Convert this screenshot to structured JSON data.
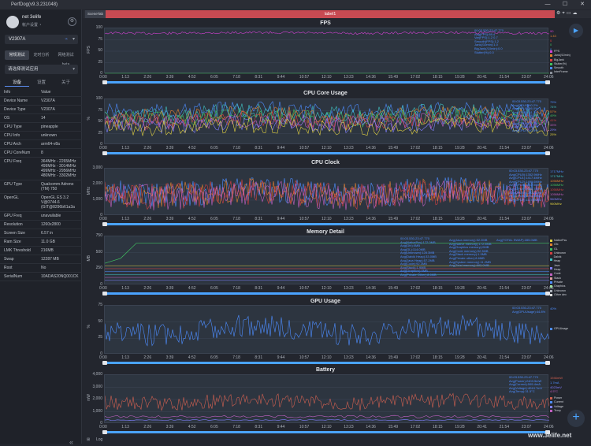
{
  "window": {
    "title": "PerfDog(v9.3.231048)",
    "min": "—",
    "max": "☐",
    "close": "✕"
  },
  "user": {
    "name": "net 3elife",
    "sub": "帐户设置 ◔"
  },
  "device_selector": {
    "label": "V2307A"
  },
  "mode_tabs": [
    {
      "label": "常规测试"
    },
    {
      "label": "定时分析"
    },
    {
      "label": "网络测试 beta"
    }
  ],
  "app_selector": {
    "placeholder": "请选择测试应用"
  },
  "info_tabs": [
    {
      "label": "设备"
    },
    {
      "label": "设置"
    },
    {
      "label": "关于"
    }
  ],
  "info": [
    {
      "k": "Info",
      "v": "Value"
    },
    {
      "k": "Device Name",
      "v": "V2307A"
    },
    {
      "k": "Device Type",
      "v": "V2307A"
    },
    {
      "k": "OS",
      "v": "14"
    },
    {
      "k": "CPU Type",
      "v": "pineapple"
    },
    {
      "k": "CPU Info",
      "v": "unknown"
    },
    {
      "k": "CPU Arch",
      "v": "arm64-v8a"
    },
    {
      "k": "CPU CoreNum",
      "v": "8"
    },
    {
      "k": "CPU Freq",
      "v": "364MHz - 2265MHz\n499MHz - 3014MHz\n499MHz - 2956MHz\n480MHz - 3302MHz"
    },
    {
      "k": "GPU Type",
      "v": "Qualcomm Adreno\n(TM) 750"
    },
    {
      "k": "OpenGL",
      "v": "OpenGL ES 3.2\nV@0744.6\n(GIT@8296b61a3a"
    },
    {
      "k": "GPU Freq",
      "v": "unavailable"
    },
    {
      "k": "Resolution",
      "v": "1260x2800"
    },
    {
      "k": "Screen Size",
      "v": "6.57 in"
    },
    {
      "k": "Ram Size",
      "v": "11.0 GB"
    },
    {
      "k": "LMK Threshold",
      "v": "216MB"
    },
    {
      "k": "Swap",
      "v": "12287 MB"
    },
    {
      "k": "Root",
      "v": "No"
    },
    {
      "k": "SerialNum",
      "v": "10ADAS20NQ001CK"
    }
  ],
  "tabs": {
    "scene": "SceneTab",
    "label": "label1"
  },
  "x_ticks": [
    "0:00",
    "1:13",
    "2:26",
    "3:39",
    "4:52",
    "6:05",
    "7:18",
    "8:31",
    "9:44",
    "10:57",
    "12:10",
    "13:23",
    "14:36",
    "15:49",
    "17:02",
    "18:15",
    "19:28",
    "20:41",
    "21:54",
    "23:07",
    "24:06"
  ],
  "panels": [
    {
      "title": "FPS",
      "unit": "FPS",
      "yticks": [
        "100",
        "75",
        "50",
        "25",
        "0"
      ],
      "ann": "00:03.530-23:47.770\nAvg(FPS):89.4\nVar(FPS):1.2 0.7\nSmooth(FPS):1.2\nJank(/10min):1.0\nBigJank(/10min):0.0\nStutter(%):0.0",
      "legend": [
        [
          "FPS",
          "#d040d0"
        ],
        [
          "Jank(/10min)",
          "#e08030"
        ],
        [
          "BigJank",
          "#e04040"
        ],
        [
          "Stutter(%)",
          "#40c060"
        ],
        [
          "Smooth",
          "#4d8dff"
        ],
        [
          "InterFrame",
          "#8a909a"
        ]
      ],
      "rvals": [
        [
          "90",
          "#d040d0"
        ],
        [
          "1.43",
          "#e08030"
        ],
        [
          "0",
          "#e04040"
        ],
        [
          "0",
          "#40c060"
        ],
        [
          "0",
          "#4d8dff"
        ]
      ]
    },
    {
      "title": "CPU Core Usage",
      "unit": "%",
      "yticks": [
        "100",
        "75",
        "50",
        "25",
        "0"
      ],
      "ann": "00:03.530-23:47.770\nAvg(CPU0):60.2%\nAvg(CPU1):56.0%\nAvg(CPU2):61.3%\nAvg(CPU3):58.9%\nAvg(CPU4):55.1%\nAvg(CPU5):51.2%\nAvg(CPU6):48.8%\nAvg(CPU7):40.5%",
      "rvals": [
        [
          "79%",
          "#4d8dff"
        ],
        [
          "74%",
          "#40c0c0"
        ],
        [
          "57%",
          "#e08030"
        ],
        [
          "49%",
          "#40c060"
        ],
        [
          "41%",
          "#d04040"
        ],
        [
          "33%",
          "#c060c0"
        ],
        [
          "29%",
          "#8080ff"
        ],
        [
          "25%",
          "#e0d040"
        ]
      ]
    },
    {
      "title": "CPU Clock",
      "unit": "MHz",
      "yticks": [
        "3,000",
        "2,000",
        "1,000",
        "0"
      ],
      "ann": "00:03.530-23:47.770\nAvg(CPU0):1352.9MHz\nAvg(CPU1):1417.4MHz\nAvg(CPU2):1491.6MHz\nAvg(CPU3):1517.5MHz\nAvg(CPU4):1420.7MHz\nAvg(CPU5):1203.1MHz\nAvg(CPU6):1264.8MHz\nAvg(CPU7):1117.6MHz",
      "rvals": [
        [
          "1717MHz",
          "#4d8dff"
        ],
        [
          "1717MHz",
          "#40c0c0"
        ],
        [
          "1056MHz",
          "#e08030"
        ],
        [
          "1056MHz",
          "#40c060"
        ],
        [
          "1056MHz",
          "#d04040"
        ],
        [
          "1056MHz",
          "#c060c0"
        ],
        [
          "960MHz",
          "#8080ff"
        ],
        [
          "960MHz",
          "#e0d040"
        ]
      ]
    },
    {
      "title": "Memory Detail",
      "unit": "MB",
      "yticks": [
        "750",
        "500",
        "250",
        "0"
      ],
      "ann": "00:03.530-23:47.770\nAvg(NativePss):172.0MB\nAvg(Gfx):0MB\nAvg(GL):114.0MB\nAvg(Unknown):128.3MB\nAvg(Dalvik Heap):33.0MB\nAvg(Java Heap):57.2MB\nAvg(Code):92.3MB\nAvg(Stack):1.9MB\nAvg(Graphics):0MB\nAvg(Private Other):8.6MB",
      "ann2": "Avg(Java memory):52.2MB\nAvg(Native memory):172.5MB\nAvg(Graphics memory):0MB\nAvg(Code memory):92.3MB\nAvg(Stack memory):1.9MB\nAvg(Private other):8.6MB\nAvg(System memory):11.2MB\nAvg(Total memory):692.0MB",
      "ann3": "Avg(TOTAL SWAP):285.0MB",
      "legend": [
        [
          "NativePss",
          "#e0d040"
        ],
        [
          "Gfx",
          "#e08030"
        ],
        [
          "GL",
          "#40c060"
        ],
        [
          "Unknown",
          "#d04040"
        ],
        [
          "Dalvik Heap",
          "#40c0c0"
        ],
        [
          "Java Heap",
          "#8080ff"
        ],
        [
          "Code",
          "#c060c0"
        ],
        [
          "Stack",
          "#e0a0a0"
        ],
        [
          "Private",
          "#4d8dff"
        ],
        [
          "Graphics",
          "#a0e0a0"
        ],
        [
          "Unknown",
          "#aab0b9"
        ],
        [
          "Other dex",
          "#e0e0e0"
        ]
      ]
    },
    {
      "title": "GPU Usage",
      "unit": "%",
      "yticks": [
        "75",
        "50",
        "25",
        "0"
      ],
      "ann": "00:03.530-23:47.770\nAvg(GPUUsage):44.8%",
      "legend": [
        [
          "GPUUsage",
          "#4d8dff"
        ]
      ],
      "rvals": [
        [
          "40%",
          "#4d8dff"
        ]
      ]
    },
    {
      "title": "Battery",
      "unit": "mW",
      "yticks": [
        "4,000",
        "3,000",
        "2,000",
        "1,000",
        "0"
      ],
      "ann": "00:03.530-23:47.770\nAvg(Power):2403.5mW\nAvg(Current):595.4mA\nAvg(Voltage):4044.7mV\nAvg(Temp):31.5°C",
      "legend": [
        [
          "Power",
          "#d06050"
        ],
        [
          "Current",
          "#4d8dff"
        ],
        [
          "Voltage",
          "#8080ff"
        ],
        [
          "Temp",
          "#c060c0"
        ]
      ],
      "rvals": [
        [
          "1946mW",
          "#d06050"
        ],
        [
          "1.7mA",
          "#4d8dff"
        ],
        [
          "4023mV",
          "#8080ff"
        ],
        [
          "4.5°C",
          "#c060c0"
        ]
      ]
    }
  ],
  "bottom": {
    "log": "Log"
  },
  "watermark": "www.3elife.net"
}
